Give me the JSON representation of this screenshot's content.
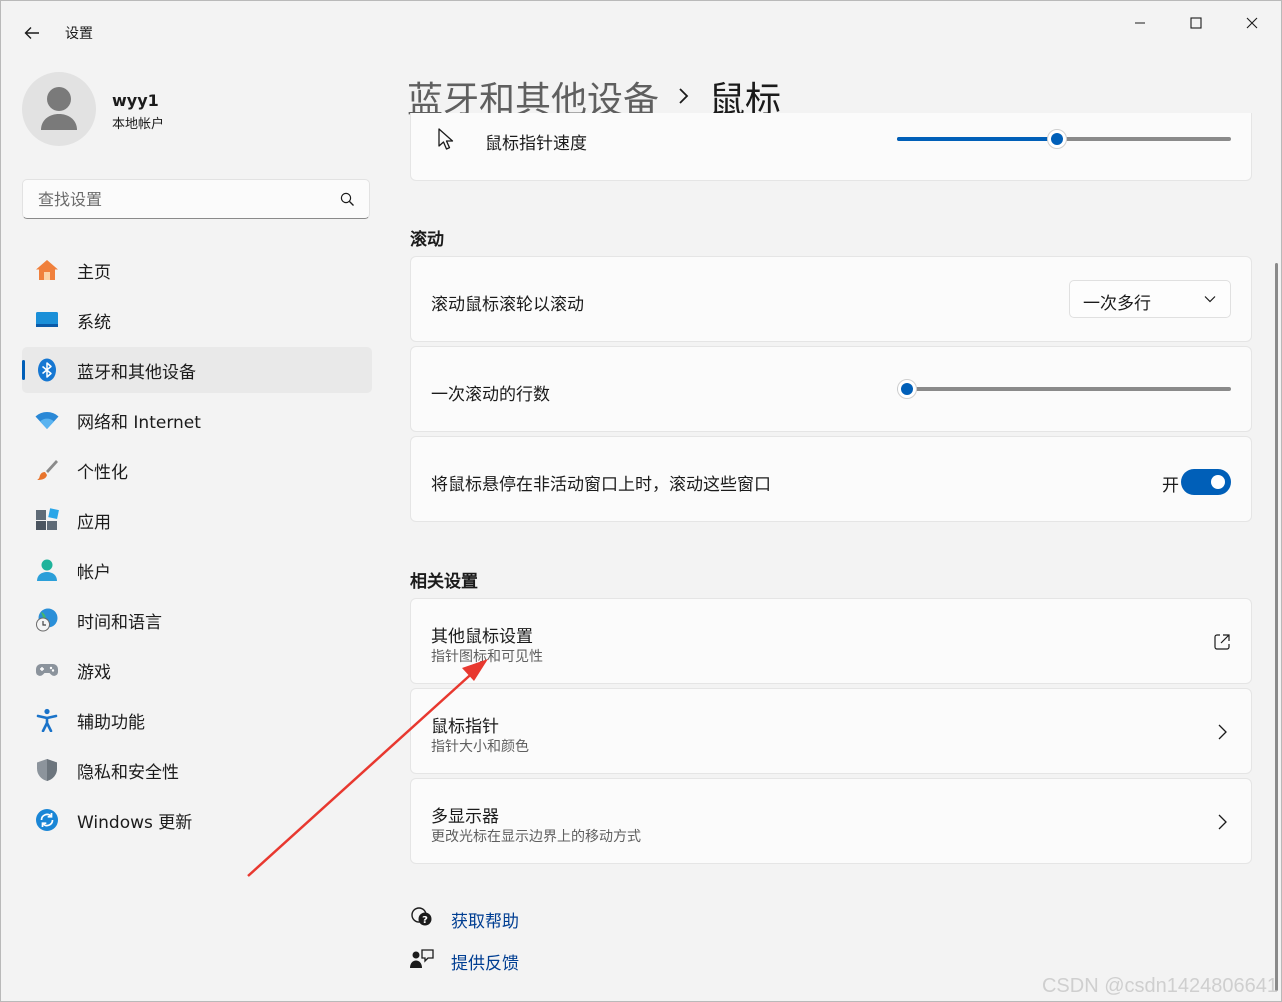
{
  "window": {
    "title": "设置",
    "back_icon": "arrow-left-icon",
    "controls": [
      "minimize-icon",
      "maximize-icon",
      "close-icon"
    ]
  },
  "profile": {
    "name": "wyy1",
    "type": "本地帐户"
  },
  "search": {
    "placeholder": "查找设置",
    "icon": "search-icon"
  },
  "nav": {
    "items": [
      {
        "label": "主页",
        "icon": "home-icon",
        "active": false
      },
      {
        "label": "系统",
        "icon": "monitor-icon",
        "active": false
      },
      {
        "label": "蓝牙和其他设备",
        "icon": "bluetooth-icon",
        "active": true
      },
      {
        "label": "网络和 Internet",
        "icon": "wifi-icon",
        "active": false
      },
      {
        "label": "个性化",
        "icon": "brush-icon",
        "active": false
      },
      {
        "label": "应用",
        "icon": "apps-icon",
        "active": false
      },
      {
        "label": "帐户",
        "icon": "person-icon",
        "active": false
      },
      {
        "label": "时间和语言",
        "icon": "globe-clock-icon",
        "active": false
      },
      {
        "label": "游戏",
        "icon": "gamepad-icon",
        "active": false
      },
      {
        "label": "辅助功能",
        "icon": "accessibility-icon",
        "active": false
      },
      {
        "label": "隐私和安全性",
        "icon": "shield-icon",
        "active": false
      },
      {
        "label": "Windows 更新",
        "icon": "update-icon",
        "active": false
      }
    ]
  },
  "header": {
    "parent": "蓝牙和其他设备",
    "separator_icon": "chevron-right-icon",
    "current": "鼠标"
  },
  "pointer_speed": {
    "label": "鼠标指针速度",
    "icon": "pointer-icon",
    "value_fraction": 0.48
  },
  "scroll_section": {
    "heading": "滚动",
    "wheel": {
      "label": "滚动鼠标滚轮以滚动",
      "value": "一次多行",
      "chevron": "chevron-down-icon"
    },
    "lines": {
      "label": "一次滚动的行数",
      "value_fraction": 0.03
    },
    "inactive": {
      "label": "将鼠标悬停在非活动窗口上时，滚动这些窗口",
      "state_label": "开",
      "on": true
    }
  },
  "related_section": {
    "heading": "相关设置",
    "items": [
      {
        "title": "其他鼠标设置",
        "desc": "指针图标和可见性",
        "icon": "external-link-icon"
      },
      {
        "title": "鼠标指针",
        "desc": "指针大小和颜色",
        "icon": "chevron-right-icon"
      },
      {
        "title": "多显示器",
        "desc": "更改光标在显示边界上的移动方式",
        "icon": "chevron-right-icon"
      }
    ]
  },
  "help": {
    "get_help": {
      "label": "获取帮助",
      "icon": "help-chat-icon"
    },
    "feedback": {
      "label": "提供反馈",
      "icon": "feedback-icon"
    }
  },
  "watermark": "CSDN @csdn1424806641",
  "colors": {
    "accent": "#005fb8",
    "annotation_arrow": "#e8382f",
    "link": "#003e92"
  }
}
